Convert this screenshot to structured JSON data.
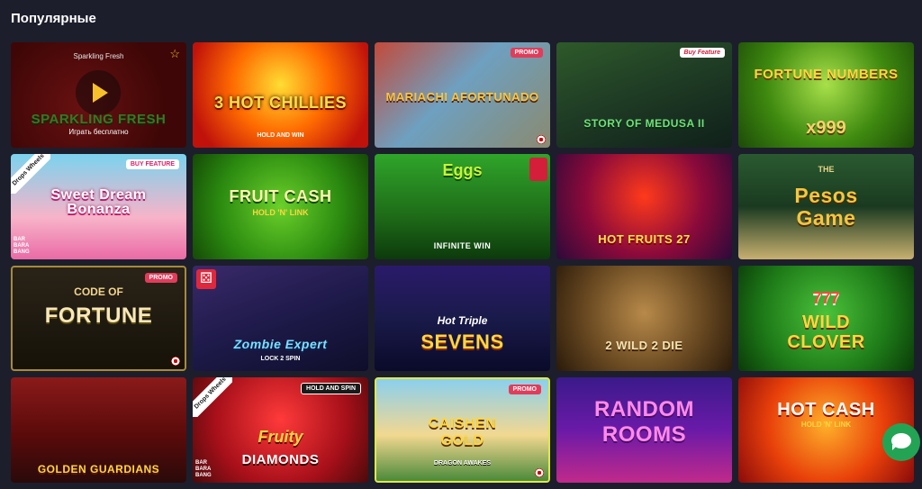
{
  "section": {
    "title": "Популярные"
  },
  "tiles": [
    {
      "name": "Sparkling Fresh",
      "title": "SPARKLING FRESH",
      "play_label": "Играть бесплатно",
      "hover_name": "Sparkling Fresh"
    },
    {
      "name": "3 Hot Chillies",
      "title": "3 HOT CHILLIES",
      "sub": "HOLD AND WIN"
    },
    {
      "name": "Mariachi Afortunado",
      "title": "MARIACHI AFORTUNADO",
      "badge": "PROMO"
    },
    {
      "name": "Story of Medusa II",
      "title": "STORY OF MEDUSA II",
      "badge": "Buy Feature"
    },
    {
      "name": "Fortune Numbers",
      "title": "FORTUNE NUMBERS",
      "sub": "x999"
    },
    {
      "name": "Sweet Dream Bonanza",
      "title": "Sweet Dream Bonanza",
      "badge": "BUY FEATURE",
      "provider_ribbon": "Drops Wheels",
      "provider_corner": "BAR BARA BANG"
    },
    {
      "name": "Fruit Cash Hold N Link",
      "title": "FRUIT CASH",
      "sub": "HOLD 'N' LINK"
    },
    {
      "name": "Infinite Win",
      "title": "INFINITE WIN",
      "sub": "Eggs"
    },
    {
      "name": "Hot Fruits 27",
      "title": "HOT FRUITS 27"
    },
    {
      "name": "Pesos Game",
      "title": "Pesos Game",
      "sub": "THE"
    },
    {
      "name": "Code of Fortune",
      "title": "FORTUNE",
      "sub": "CODE OF",
      "badge": "PROMO"
    },
    {
      "name": "Zombie Expert",
      "title": "Zombie Expert",
      "sub": "LOCK 2 SPIN"
    },
    {
      "name": "Hot Triple Sevens",
      "title": "SEVENS",
      "sub": "Hot Triple"
    },
    {
      "name": "2 Wild 2 Die",
      "title": "2 WILD 2 DIE"
    },
    {
      "name": "777 Wild Clover",
      "title": "WILD CLOVER",
      "sub": "777"
    },
    {
      "name": "Golden Guardians",
      "title": "GOLDEN GUARDIANS"
    },
    {
      "name": "Fruity Diamonds Hold and Spin",
      "title": "DIAMONDS",
      "sub": "Fruity",
      "badge": "HOLD AND SPIN",
      "provider_ribbon": "Drops Wheels",
      "provider_corner": "BAR BARA BANG"
    },
    {
      "name": "Caishen Gold Dragon Awakes",
      "title": "CAISHEN GOLD",
      "sub": "DRAGON AWAKES",
      "badge": "PROMO"
    },
    {
      "name": "Random Rooms",
      "title": "RANDOM ROOMS"
    },
    {
      "name": "Hot Cash Hold N Link",
      "title": "HOT CASH",
      "sub": "HOLD 'N' LINK"
    }
  ],
  "colors": {
    "page_bg": "#1c1e2c",
    "accent_play": "#f5c02a",
    "promo": "#e23c5a",
    "chat": "#23a455"
  }
}
